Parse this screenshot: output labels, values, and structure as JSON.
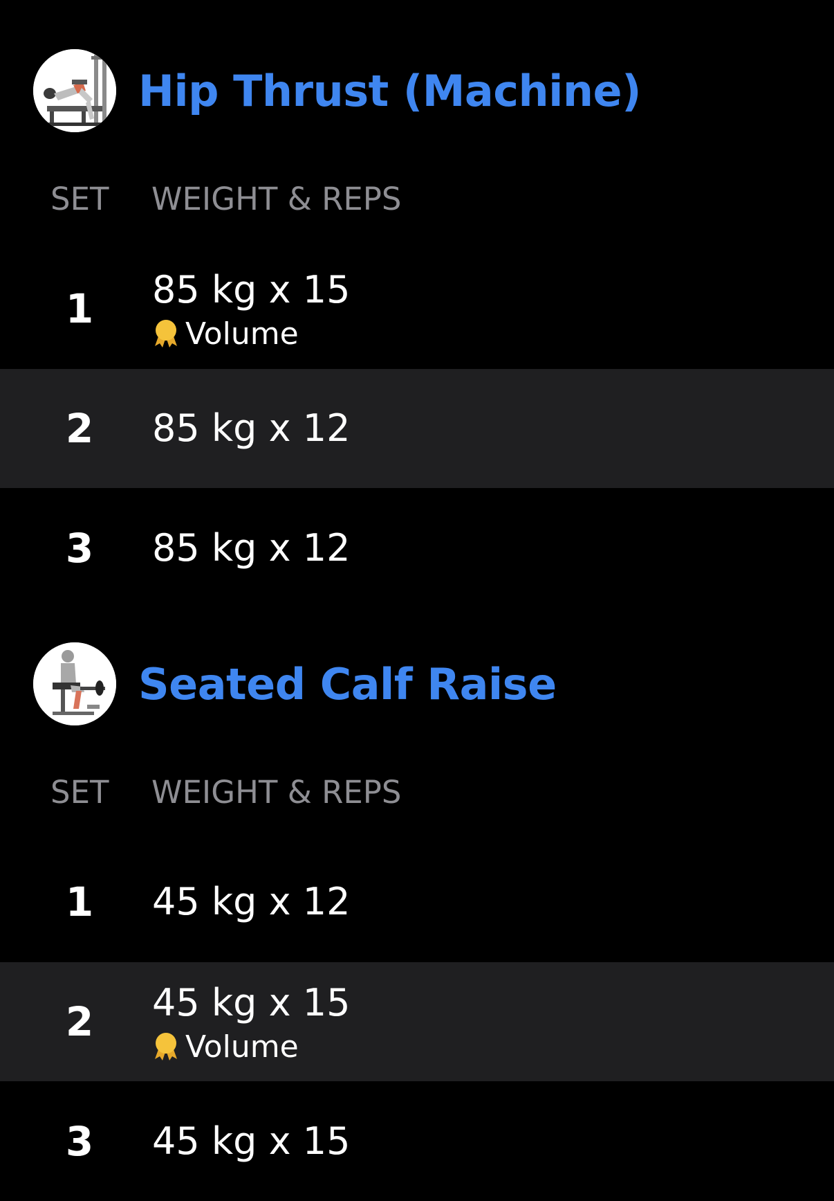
{
  "colors": {
    "background": "#000000",
    "alt_row": "#1f1f21",
    "accent": "#3f86f0",
    "header_text": "#8e8e93",
    "medal": "#f5c33b"
  },
  "columns": {
    "set": "SET",
    "weight_reps": "WEIGHT & REPS"
  },
  "exercises": [
    {
      "title": "Hip Thrust (Machine)",
      "thumbnail": "hip-thrust-machine-illustration",
      "sets": [
        {
          "set": "1",
          "value": "85 kg x 15",
          "record": "Volume"
        },
        {
          "set": "2",
          "value": "85 kg x 12"
        },
        {
          "set": "3",
          "value": "85 kg x 12"
        }
      ]
    },
    {
      "title": "Seated Calf Raise",
      "thumbnail": "seated-calf-raise-illustration",
      "sets": [
        {
          "set": "1",
          "value": "45 kg x 12"
        },
        {
          "set": "2",
          "value": "45 kg x 15",
          "record": "Volume"
        },
        {
          "set": "3",
          "value": "45 kg x 15"
        }
      ]
    }
  ]
}
